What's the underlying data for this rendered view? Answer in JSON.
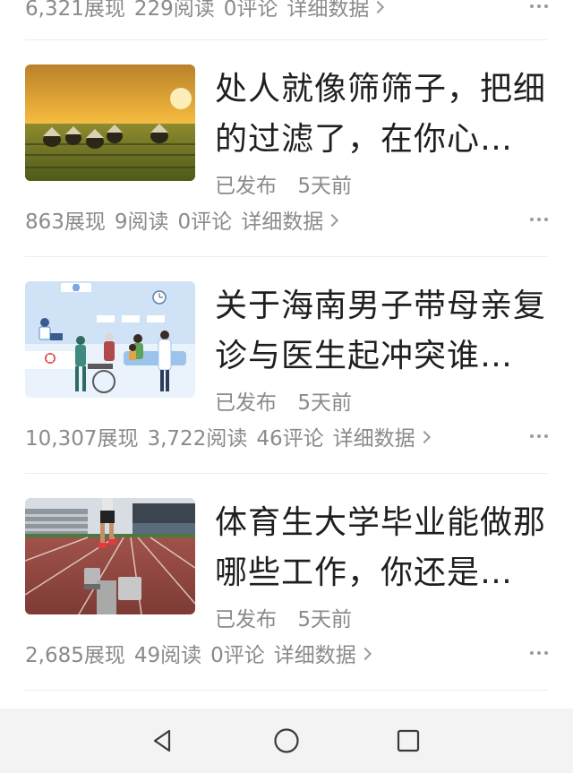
{
  "top_stats": {
    "impressions": "6,321展现",
    "reads": "229阅读",
    "comments": "0评论",
    "detail_label": "详细数据"
  },
  "articles": [
    {
      "title": "处人就像筛筛子，把细的过滤了，在你心…",
      "status": "已发布",
      "time": "5天前",
      "impressions": "863展现",
      "reads": "9阅读",
      "comments": "0评论",
      "detail_label": "详细数据",
      "thumb_icon": "rice-field-sunset-image"
    },
    {
      "title": "关于海南男子带母亲复诊与医生起冲突谁…",
      "status": "已发布",
      "time": "5天前",
      "impressions": "10,307展现",
      "reads": "3,722阅读",
      "comments": "46评论",
      "detail_label": "详细数据",
      "thumb_icon": "hospital-illustration-image"
    },
    {
      "title": "体育生大学毕业能做那哪些工作，你还是…",
      "status": "已发布",
      "time": "5天前",
      "impressions": "2,685展现",
      "reads": "49阅读",
      "comments": "0评论",
      "detail_label": "详细数据",
      "thumb_icon": "running-track-image"
    }
  ],
  "navbar": {
    "back_icon": "back-triangle-icon",
    "home_icon": "home-circle-icon",
    "recents_icon": "recents-square-icon"
  },
  "colors": {
    "text_primary": "#1f1f1f",
    "text_secondary": "#8a8a8a",
    "divider": "#ececec",
    "navbar_bg": "#f3f3f3"
  }
}
